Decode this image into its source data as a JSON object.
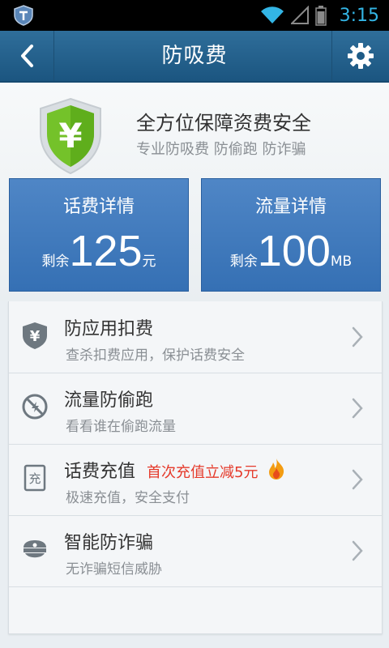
{
  "status_bar": {
    "time": "3:15"
  },
  "title_bar": {
    "title": "防吸费"
  },
  "hero": {
    "headline": "全方位保障资费安全",
    "subline": "专业防吸费 防偷跑 防诈骗",
    "shield_symbol": "¥"
  },
  "cards": [
    {
      "title": "话费详情",
      "prefix": "剩余",
      "value": "125",
      "unit": "元"
    },
    {
      "title": "流量详情",
      "prefix": "剩余",
      "value": "100",
      "unit": "MB"
    }
  ],
  "list": [
    {
      "title": "防应用扣费",
      "subtitle": "查杀扣费应用，保护话费安全",
      "icon": "yuan-shield-icon"
    },
    {
      "title": "流量防偷跑",
      "subtitle": "看看谁在偷跑流量",
      "icon": "traffic-block-icon"
    },
    {
      "title": "话费充值",
      "promo": "首次充值立减5元",
      "subtitle": "极速充值，安全支付",
      "icon": "recharge-icon"
    },
    {
      "title": "智能防诈骗",
      "subtitle": "无诈骗短信威胁",
      "icon": "police-cap-icon"
    }
  ],
  "colors": {
    "title_bar": "#1b5580",
    "card": "#3f7bbf",
    "promo": "#e53a2b",
    "shield_green": "#74c22a"
  }
}
